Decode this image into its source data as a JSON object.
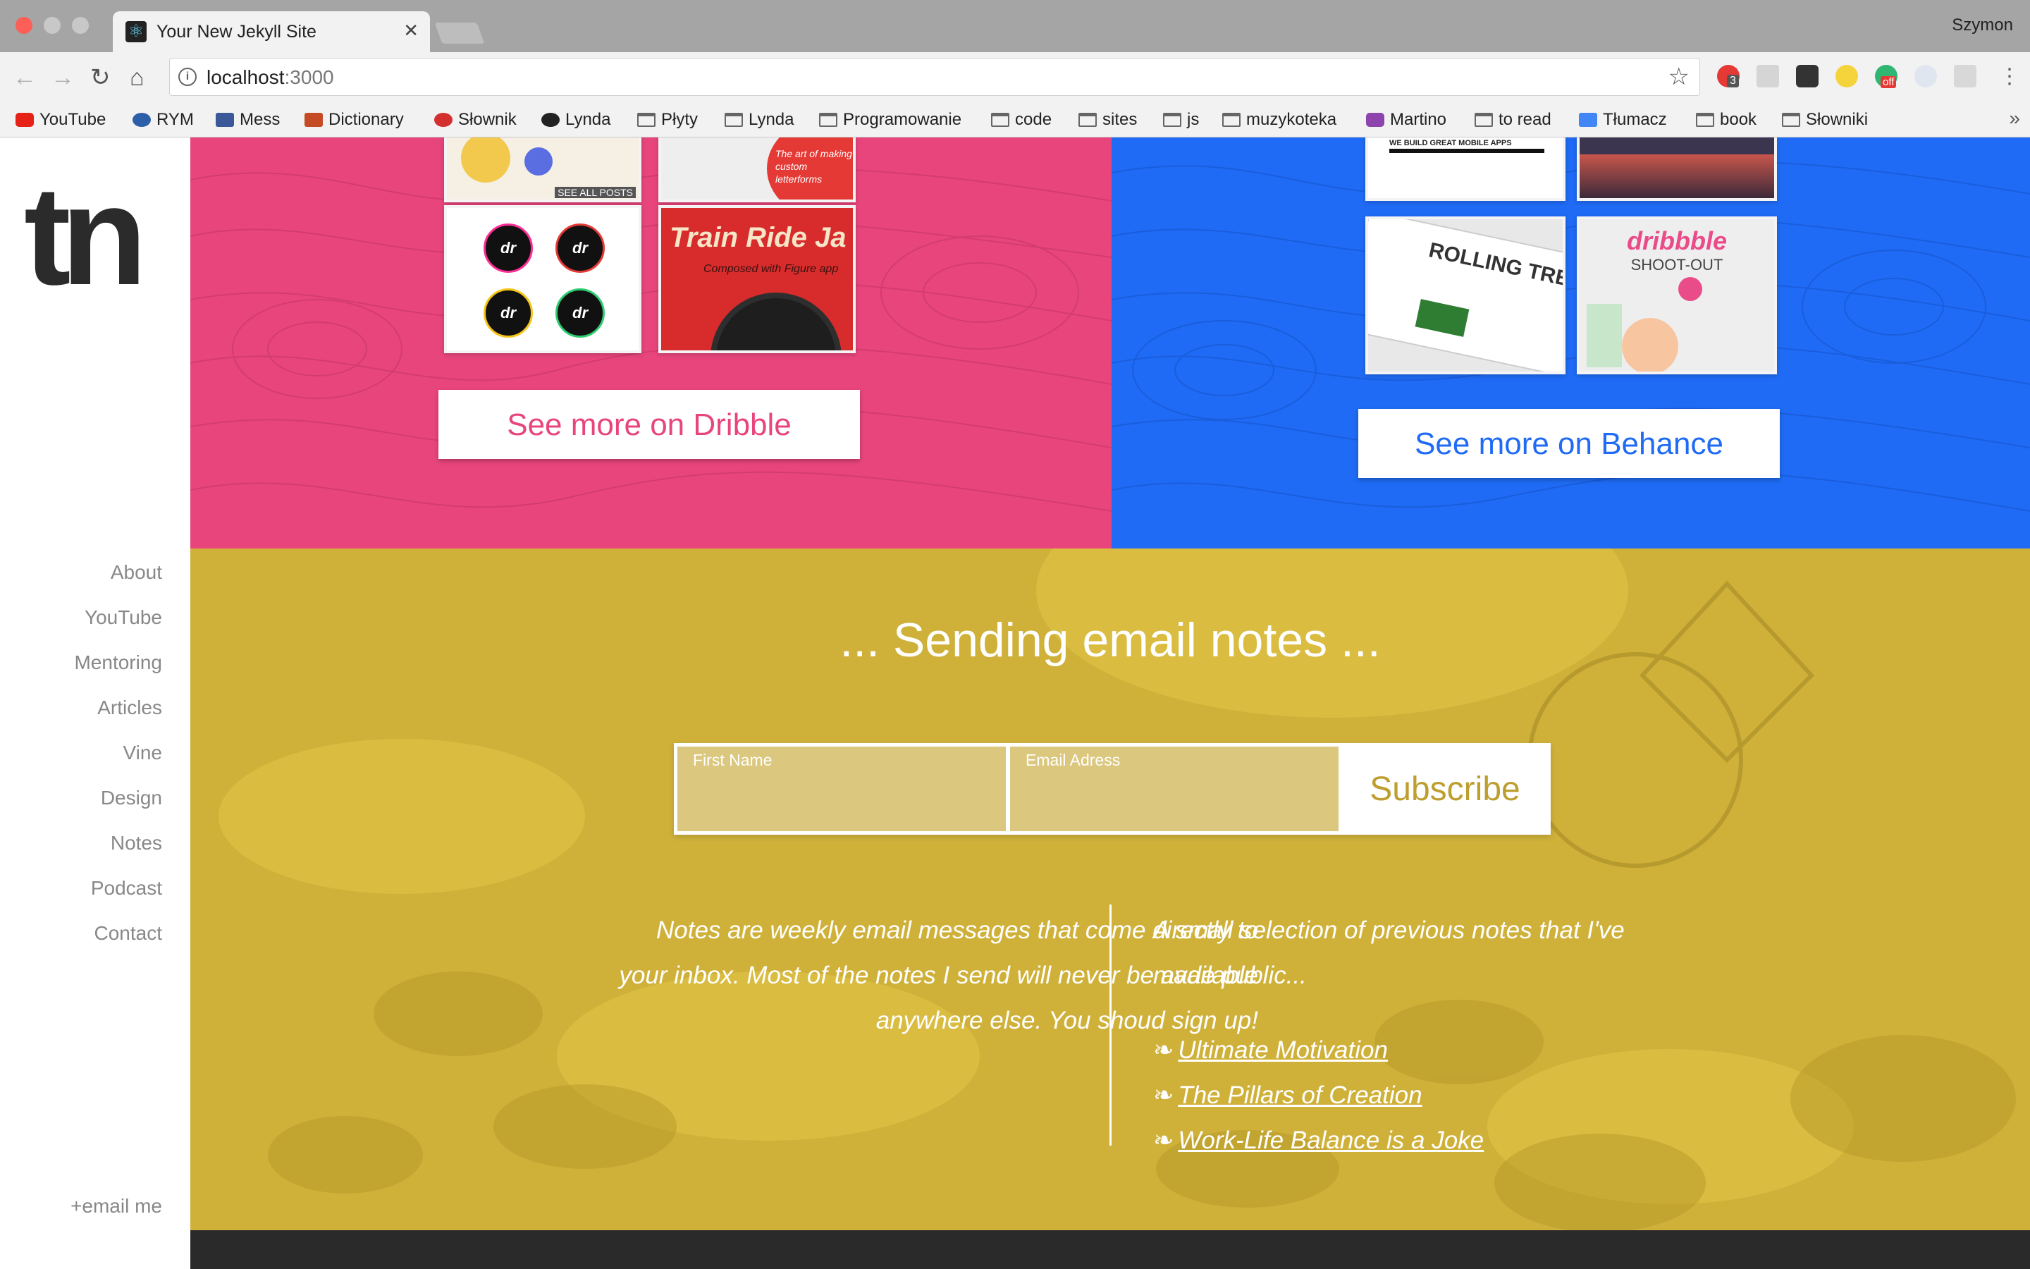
{
  "browser": {
    "tab_title": "Your New Jekyll Site",
    "profile_name": "Szymon",
    "url_host": "localhost",
    "url_port": ":3000",
    "bookmarks": [
      {
        "label": "YouTube",
        "icon": "youtube-icon"
      },
      {
        "label": "RYM",
        "icon": "rym-icon"
      },
      {
        "label": "Mess",
        "icon": "facebook-icon"
      },
      {
        "label": "Dictionary",
        "icon": "dictionary-icon"
      },
      {
        "label": "Słownik",
        "icon": "diki-icon"
      },
      {
        "label": "Lynda",
        "icon": "lynda-icon"
      },
      {
        "label": "Płyty",
        "icon": "folder-icon"
      },
      {
        "label": "Lynda",
        "icon": "folder-icon"
      },
      {
        "label": "Programowanie",
        "icon": "folder-icon"
      },
      {
        "label": "code",
        "icon": "folder-icon"
      },
      {
        "label": "sites",
        "icon": "folder-icon"
      },
      {
        "label": "js",
        "icon": "folder-icon"
      },
      {
        "label": "muzykoteka",
        "icon": "folder-icon"
      },
      {
        "label": "Martino",
        "icon": "martino-icon"
      },
      {
        "label": "to read",
        "icon": "folder-icon"
      },
      {
        "label": "Tłumacz",
        "icon": "google-translate-icon"
      },
      {
        "label": "book",
        "icon": "folder-icon"
      },
      {
        "label": "Słowniki",
        "icon": "folder-icon"
      }
    ],
    "extension_badge": "3",
    "extension_off_label": "off"
  },
  "sidebar": {
    "logo": "tn",
    "nav": [
      "About",
      "YouTube",
      "Mentoring",
      "Articles",
      "Vine",
      "Design",
      "Notes",
      "Podcast",
      "Contact"
    ],
    "email_me": "+email me"
  },
  "portfolio": {
    "dribbble_cta": "See more on Dribble",
    "behance_cta": "See more on Behance",
    "dribbble_shots": {
      "train_title": "Train Ride Ja",
      "train_subtitle": "Composed with Figure app",
      "dr_badge": "dr",
      "posts_label": "SEE ALL POSTS",
      "lettering_text": "The art of making custom letterforms"
    },
    "behance_shots": {
      "dribbble_logo": "dribbble",
      "shootout": "SHOOT-OUT",
      "rolling": "ROLLING TREE",
      "mobile_tag": "WE BUILD GREAT MOBILE APPS"
    },
    "colors": {
      "pink": "#e8457c",
      "blue": "#1f6bf5",
      "gold": "#cfb13a"
    }
  },
  "newsletter": {
    "title": "... Sending email notes ...",
    "first_name_label": "First Name",
    "email_label": "Email Adress",
    "subscribe_label": "Subscribe",
    "description": "Notes are weekly email messages that come directly to your inbox. Most of the notes I send will never be available anywhere else. You shoud sign up!",
    "intro": "A small selection of previous notes that I've made public...",
    "links": [
      "Ultimate Motivation",
      "The Pillars of Creation",
      "Work-Life Balance is a Joke"
    ],
    "fleuron": "❧"
  }
}
